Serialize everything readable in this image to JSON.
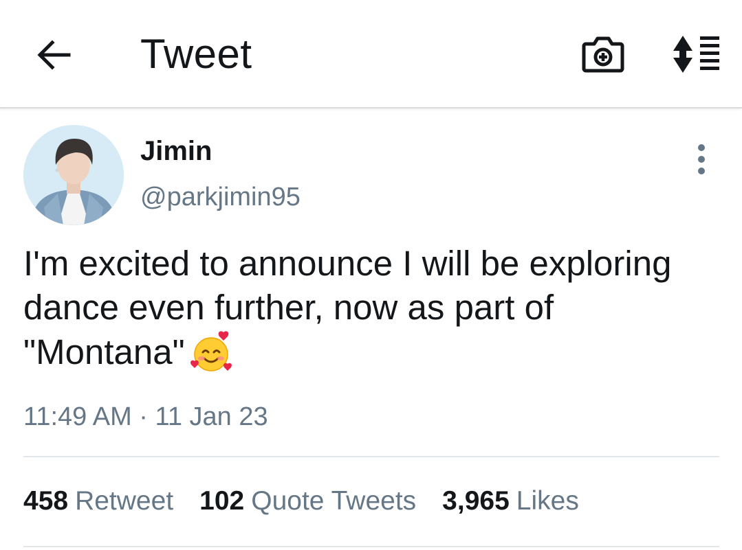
{
  "header": {
    "title": "Tweet",
    "back_icon": "arrow-left-icon",
    "camera_icon": "camera-plus-icon",
    "sort_icon": "sort-arrows-list-icon"
  },
  "tweet": {
    "author": {
      "display_name": "Jimin",
      "handle": "@parkjimin95"
    },
    "text": "I'm excited to announce I will be exploring dance even further, now as part of \"Montana\"",
    "emoji": "smiling-face-with-hearts-icon",
    "timestamp": "11:49 AM · 11 Jan 23",
    "stats": {
      "retweets": {
        "count": "458",
        "label": "Retweet"
      },
      "quotes": {
        "count": "102",
        "label": "Quote Tweets"
      },
      "likes": {
        "count": "3,965",
        "label": "Likes"
      }
    }
  },
  "colors": {
    "primary_text": "#14171a",
    "secondary_text": "#657786",
    "divider": "#e3e6e8",
    "background": "#ffffff"
  }
}
